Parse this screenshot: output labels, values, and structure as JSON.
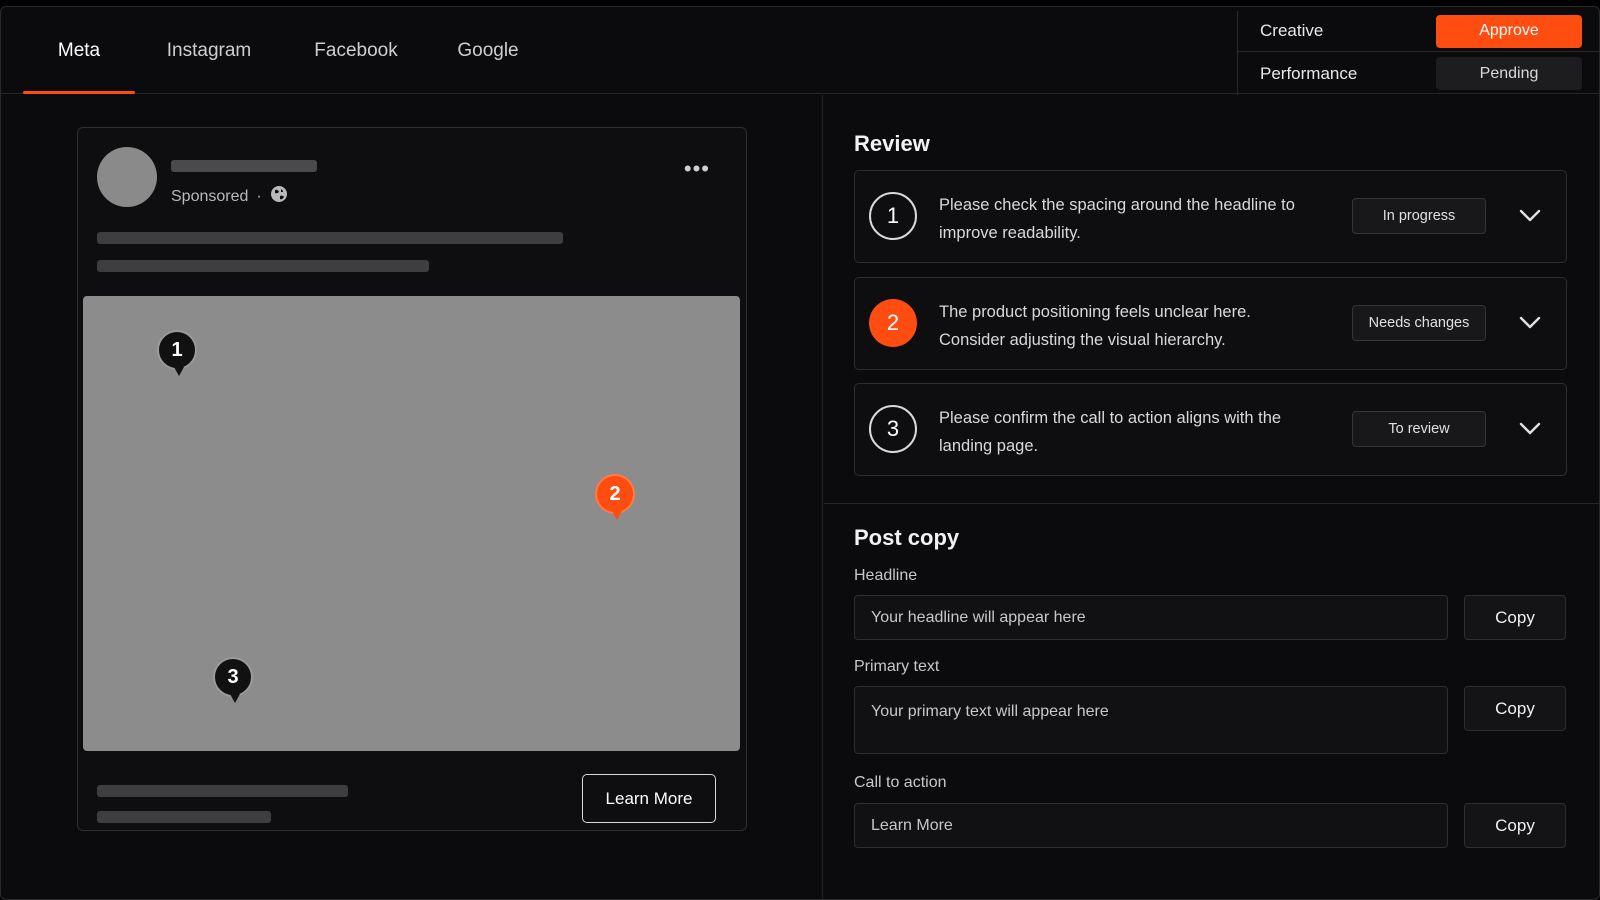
{
  "tabs": [
    {
      "label": "Meta",
      "active": true
    },
    {
      "label": "Instagram",
      "active": false
    },
    {
      "label": "Facebook",
      "active": false
    },
    {
      "label": "Google",
      "active": false
    }
  ],
  "status": {
    "creative_label": "Creative",
    "creative_value": "Approve",
    "performance_label": "Performance",
    "performance_value": "Pending"
  },
  "post_preview": {
    "sponsored": "Sponsored",
    "separator": "·",
    "globe_icon": "globe-icon",
    "more_icon": "more-horizontal-icon",
    "more_glyph": "•••",
    "pins": [
      "1",
      "2",
      "3"
    ],
    "cta": "Learn More"
  },
  "review": {
    "title": "Review",
    "items": [
      {
        "number": "1",
        "text": "Please check the spacing around the headline to improve readability.",
        "status": "In progress",
        "highlight": false
      },
      {
        "number": "2",
        "text": "The product positioning feels unclear here. Consider adjusting the visual hierarchy.",
        "status": "Needs changes",
        "highlight": true
      },
      {
        "number": "3",
        "text": "Please confirm the call to action aligns with the landing page.",
        "status": "To review",
        "highlight": false
      }
    ]
  },
  "post_copy": {
    "title": "Post copy",
    "headline_label": "Headline",
    "headline_placeholder": "Your headline will appear here",
    "primary_label": "Primary text",
    "primary_placeholder": "Your primary text will appear here",
    "cta_label": "Call to action",
    "cta_value": "Learn More",
    "copy_label": "Copy"
  },
  "colors": {
    "accent": "#ff4d12",
    "background": "#0b0b0d",
    "creative_placeholder": "#8c8c8c"
  }
}
